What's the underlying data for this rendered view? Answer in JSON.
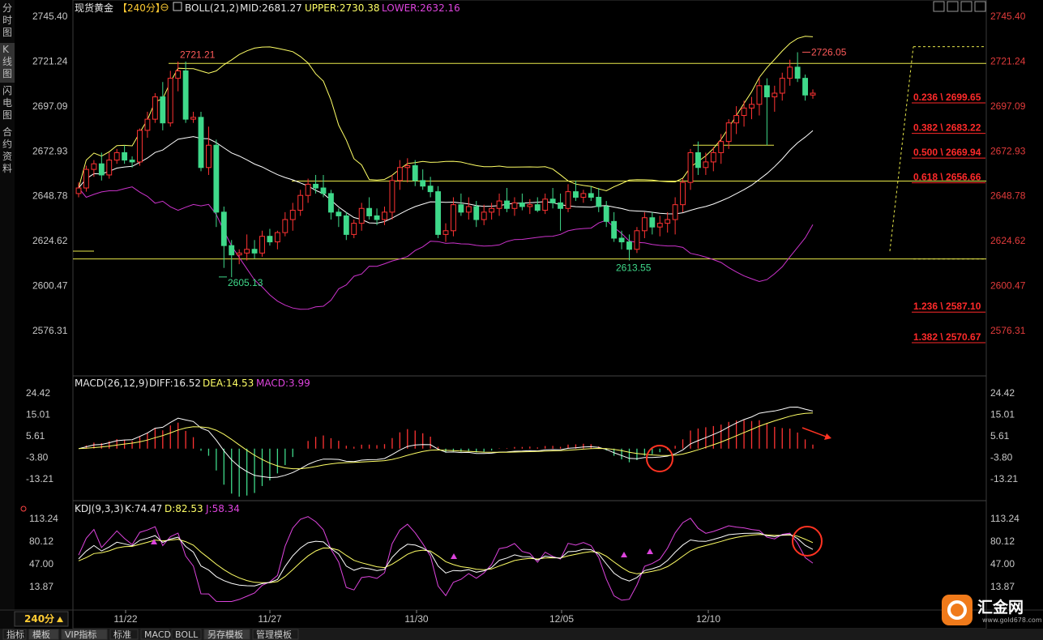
{
  "symbol": "现货黄金",
  "period": "【240分】",
  "side_tabs": [
    "分时图",
    "K线图",
    "闪电图",
    "合约资料"
  ],
  "boll": {
    "label": "BOLL(21,2)",
    "mid": "MID:2681.27",
    "upper": "UPPER:2730.38",
    "lower": "LOWER:2632.16"
  },
  "price_axis": [
    "2745.40",
    "2721.24",
    "2697.09",
    "2672.93",
    "2648.78",
    "2624.62",
    "2600.47",
    "2576.31"
  ],
  "annotations": {
    "high_left": "2721.21",
    "low_left": "2605.13",
    "low_mid": "2613.55",
    "high_right": "2726.05"
  },
  "fib_levels": [
    {
      "text": "0.236 \\ 2699.65",
      "value": 2699.65
    },
    {
      "text": "0.382 \\ 2683.22",
      "value": 2683.22
    },
    {
      "text": "0.500 \\ 2669.94",
      "value": 2669.94
    },
    {
      "text": "0.618 \\ 2656.66",
      "value": 2656.66
    },
    {
      "text": "1.236 \\ 2587.10",
      "value": 2587.1
    },
    {
      "text": "1.382 \\ 2570.67",
      "value": 2570.67
    }
  ],
  "macd": {
    "label": "MACD(26,12,9)",
    "diff": "DIFF:16.52",
    "dea": "DEA:14.53",
    "macd": "MACD:3.99",
    "axis": [
      "24.42",
      "15.01",
      "5.61",
      "-3.80",
      "-13.21"
    ]
  },
  "kdj": {
    "label": "KDJ(9,3,3)",
    "k": "K:74.47",
    "d": "D:82.53",
    "j": "J:58.34",
    "axis": [
      "113.24",
      "80.12",
      "47.00",
      "13.87"
    ]
  },
  "x_labels": [
    "11/22",
    "11/27",
    "11/30",
    "12/05",
    "12/10"
  ],
  "period_badge": "240分",
  "bottom_buttons": [
    "指标",
    "模板",
    "VIP指标",
    "标准",
    "MACD",
    "BOLL",
    "另存模板",
    "管理模板"
  ],
  "logo": {
    "name": "汇金网",
    "url": "www.gold678.com"
  },
  "colors": {
    "up": "#ff3333",
    "down": "#3fd98a",
    "boll_upper": "#ffff66",
    "boll_mid": "#ffffff",
    "boll_lower": "#cc33cc",
    "fib": "#ff2a2a",
    "axis_price": "#e23b3b"
  },
  "chart_data": {
    "type": "candlestick",
    "interval": "240分",
    "ylim": [
      2552,
      2754
    ],
    "ohlc": [
      [
        2650,
        2656,
        2648,
        2653
      ],
      [
        2653,
        2665,
        2651,
        2663
      ],
      [
        2663,
        2668,
        2659,
        2666
      ],
      [
        2666,
        2672,
        2657,
        2660
      ],
      [
        2660,
        2672,
        2658,
        2668
      ],
      [
        2668,
        2674,
        2666,
        2672
      ],
      [
        2672,
        2676,
        2666,
        2668
      ],
      [
        2668,
        2670,
        2664,
        2667
      ],
      [
        2667,
        2685,
        2665,
        2684
      ],
      [
        2684,
        2694,
        2680,
        2690
      ],
      [
        2690,
        2704,
        2688,
        2702
      ],
      [
        2702,
        2710,
        2684,
        2688
      ],
      [
        2688,
        2716,
        2686,
        2712
      ],
      [
        2712,
        2721,
        2705,
        2716
      ],
      [
        2716,
        2721,
        2688,
        2690
      ],
      [
        2690,
        2694,
        2688,
        2691
      ],
      [
        2691,
        2694,
        2662,
        2664
      ],
      [
        2664,
        2686,
        2660,
        2676
      ],
      [
        2676,
        2679,
        2632,
        2640
      ],
      [
        2640,
        2643,
        2610,
        2622
      ],
      [
        2622,
        2625,
        2605,
        2617
      ],
      [
        2617,
        2620,
        2612,
        2618
      ],
      [
        2618,
        2628,
        2614,
        2620
      ],
      [
        2620,
        2625,
        2615,
        2618
      ],
      [
        2618,
        2630,
        2616,
        2627
      ],
      [
        2627,
        2631,
        2622,
        2624
      ],
      [
        2624,
        2630,
        2620,
        2629
      ],
      [
        2629,
        2640,
        2627,
        2636
      ],
      [
        2636,
        2645,
        2630,
        2641
      ],
      [
        2641,
        2652,
        2638,
        2649
      ],
      [
        2649,
        2658,
        2645,
        2655
      ],
      [
        2655,
        2660,
        2650,
        2653
      ],
      [
        2653,
        2660,
        2648,
        2650
      ],
      [
        2650,
        2652,
        2636,
        2640
      ],
      [
        2640,
        2642,
        2632,
        2638
      ],
      [
        2638,
        2640,
        2625,
        2628
      ],
      [
        2628,
        2636,
        2626,
        2634
      ],
      [
        2634,
        2645,
        2630,
        2642
      ],
      [
        2642,
        2648,
        2636,
        2638
      ],
      [
        2638,
        2642,
        2633,
        2636
      ],
      [
        2636,
        2643,
        2633,
        2640
      ],
      [
        2640,
        2660,
        2636,
        2657
      ],
      [
        2657,
        2668,
        2652,
        2664
      ],
      [
        2664,
        2669,
        2656,
        2665
      ],
      [
        2665,
        2668,
        2654,
        2657
      ],
      [
        2657,
        2663,
        2652,
        2654
      ],
      [
        2654,
        2659,
        2648,
        2651
      ],
      [
        2651,
        2654,
        2626,
        2628
      ],
      [
        2628,
        2634,
        2624,
        2630
      ],
      [
        2630,
        2648,
        2627,
        2644
      ],
      [
        2644,
        2650,
        2638,
        2640
      ],
      [
        2640,
        2648,
        2636,
        2643
      ],
      [
        2643,
        2646,
        2632,
        2636
      ],
      [
        2636,
        2644,
        2633,
        2640
      ],
      [
        2640,
        2645,
        2636,
        2642
      ],
      [
        2642,
        2650,
        2638,
        2646
      ],
      [
        2646,
        2653,
        2640,
        2642
      ],
      [
        2642,
        2648,
        2638,
        2645
      ],
      [
        2645,
        2650,
        2641,
        2643
      ],
      [
        2643,
        2647,
        2639,
        2644
      ],
      [
        2644,
        2648,
        2640,
        2641
      ],
      [
        2641,
        2650,
        2639,
        2647
      ],
      [
        2647,
        2653,
        2642,
        2645
      ],
      [
        2645,
        2650,
        2630,
        2642
      ],
      [
        2642,
        2655,
        2640,
        2651
      ],
      [
        2651,
        2657,
        2646,
        2648
      ],
      [
        2648,
        2652,
        2645,
        2650
      ],
      [
        2650,
        2654,
        2646,
        2648
      ],
      [
        2648,
        2653,
        2640,
        2643
      ],
      [
        2643,
        2646,
        2632,
        2635
      ],
      [
        2635,
        2640,
        2624,
        2626
      ],
      [
        2626,
        2630,
        2620,
        2624
      ],
      [
        2624,
        2628,
        2614,
        2620
      ],
      [
        2620,
        2632,
        2618,
        2630
      ],
      [
        2630,
        2640,
        2626,
        2637
      ],
      [
        2637,
        2640,
        2628,
        2632
      ],
      [
        2632,
        2638,
        2627,
        2634
      ],
      [
        2634,
        2640,
        2629,
        2636
      ],
      [
        2636,
        2648,
        2628,
        2644
      ],
      [
        2644,
        2658,
        2640,
        2656
      ],
      [
        2656,
        2674,
        2652,
        2672
      ],
      [
        2672,
        2678,
        2660,
        2664
      ],
      [
        2664,
        2672,
        2660,
        2667
      ],
      [
        2667,
        2675,
        2662,
        2672
      ],
      [
        2672,
        2682,
        2666,
        2678
      ],
      [
        2678,
        2690,
        2674,
        2688
      ],
      [
        2688,
        2697,
        2682,
        2692
      ],
      [
        2692,
        2700,
        2686,
        2696
      ],
      [
        2696,
        2702,
        2690,
        2698
      ],
      [
        2698,
        2712,
        2692,
        2708
      ],
      [
        2708,
        2712,
        2676,
        2702
      ],
      [
        2702,
        2708,
        2694,
        2704
      ],
      [
        2704,
        2715,
        2700,
        2712
      ],
      [
        2712,
        2722,
        2708,
        2718
      ],
      [
        2718,
        2726,
        2710,
        2712
      ],
      [
        2712,
        2714,
        2700,
        2703
      ],
      [
        2703,
        2706,
        2701,
        2704
      ]
    ],
    "fib_levels": [
      2699.65,
      2683.22,
      2669.94,
      2656.66,
      2587.1,
      2570.67
    ],
    "macd": {
      "ylim": [
        -22,
        30
      ],
      "diff_last": 16.52,
      "dea_last": 14.53,
      "macd_last": 3.99
    },
    "kdj": {
      "ylim": [
        -5,
        125
      ],
      "k_last": 74.47,
      "d_last": 82.53,
      "j_last": 58.34
    }
  }
}
